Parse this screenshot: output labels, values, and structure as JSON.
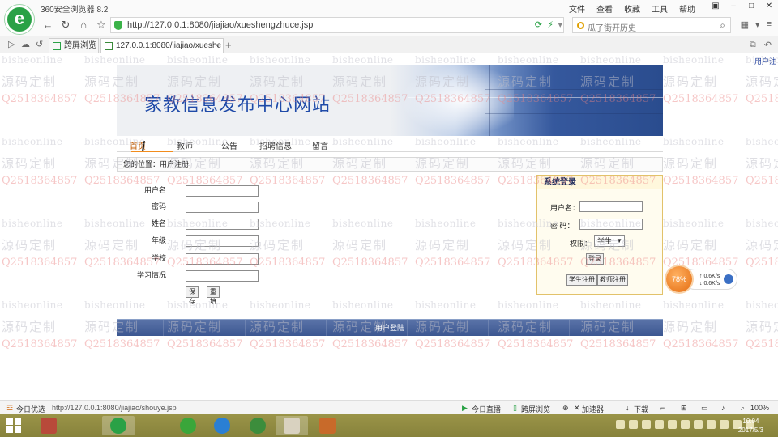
{
  "browser": {
    "app_title": "360安全浏览器 8.2",
    "menu": [
      "文件",
      "查看",
      "收藏",
      "工具",
      "帮助"
    ],
    "logo_char": "e",
    "url": "http://127.0.0.1:8080/jiajiao/xueshengzhuce.jsp",
    "search_placeholder": "瓜了街开历史",
    "tabs": [
      {
        "label": "跨屏浏览"
      },
      {
        "label": "127.0.0.1:8080/jiajiao/xueshe",
        "close": "×"
      }
    ],
    "new_tab": "+"
  },
  "page": {
    "user_link": "用户注",
    "site_title": "家教信息发布中心网站",
    "nav": [
      "首页",
      "教师",
      "公告",
      "招聘信息",
      "留言"
    ],
    "breadcrumb": "您的位置：用户注册",
    "form": {
      "fields": [
        {
          "label": "用户名",
          "value": ""
        },
        {
          "label": "密码",
          "value": ""
        },
        {
          "label": "姓名",
          "value": ""
        },
        {
          "label": "年级",
          "value": ""
        },
        {
          "label": "学校",
          "value": ""
        },
        {
          "label": "学习情况",
          "value": ""
        }
      ],
      "save_label": "保存",
      "reset_label": "重填"
    },
    "login": {
      "title": "系统登录",
      "username_label": "用户名：",
      "password_label": "密  码：",
      "role_label": "权限：",
      "role_value": "学生",
      "role_arrow": "▼",
      "login_button": "登录",
      "student_register": "学生注册",
      "teacher_register": "教师注册"
    },
    "footer_text": "用户登陆"
  },
  "speed_widget": {
    "percent": "78%",
    "up": "↑ 0.6K/s",
    "down": "↓ 0.6K/s"
  },
  "watermarks": {
    "site": "bisheonline",
    "brand": "源码定制",
    "qq": "Q2518364857"
  },
  "statusbar": {
    "left_label": "今日优选",
    "hover_url": "http://127.0.0.1:8080/jiajiao/shouye.jsp",
    "items": [
      "今日直播",
      "跨屏浏览",
      "加速器",
      "下载"
    ],
    "zoom": "100%"
  },
  "taskbar": {
    "time": "10:04",
    "date": "2017/5/3"
  },
  "colors": {
    "menu_accent": "#f28c1c",
    "footer_bg": "#3c5791",
    "title_blue": "#1f4aa8",
    "login_border": "#e2c26a"
  }
}
